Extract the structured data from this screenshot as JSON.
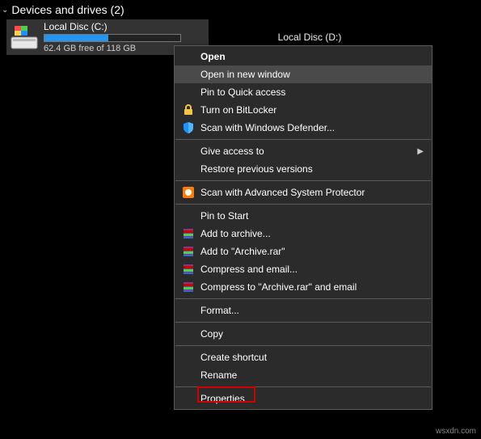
{
  "section": {
    "title": "Devices and drives (2)"
  },
  "drives": {
    "c": {
      "label": "Local Disc (C:)",
      "free_text": "62.4 GB free of 118 GB",
      "used_pct": 47
    },
    "d": {
      "label": "Local Disc (D:)"
    }
  },
  "menu": {
    "open": "Open",
    "open_new_window": "Open in new window",
    "pin_quick": "Pin to Quick access",
    "bitlocker": "Turn on BitLocker",
    "defender": "Scan with Windows Defender...",
    "give_access": "Give access to",
    "restore_prev": "Restore previous versions",
    "asp": "Scan with Advanced System Protector",
    "pin_start": "Pin to Start",
    "add_archive": "Add to archive...",
    "add_archive_rar": "Add to \"Archive.rar\"",
    "compress_email": "Compress and email...",
    "compress_rar_email": "Compress to \"Archive.rar\" and email",
    "format": "Format...",
    "copy": "Copy",
    "create_shortcut": "Create shortcut",
    "rename": "Rename",
    "properties": "Properties"
  },
  "watermark": "wsxdn.com"
}
